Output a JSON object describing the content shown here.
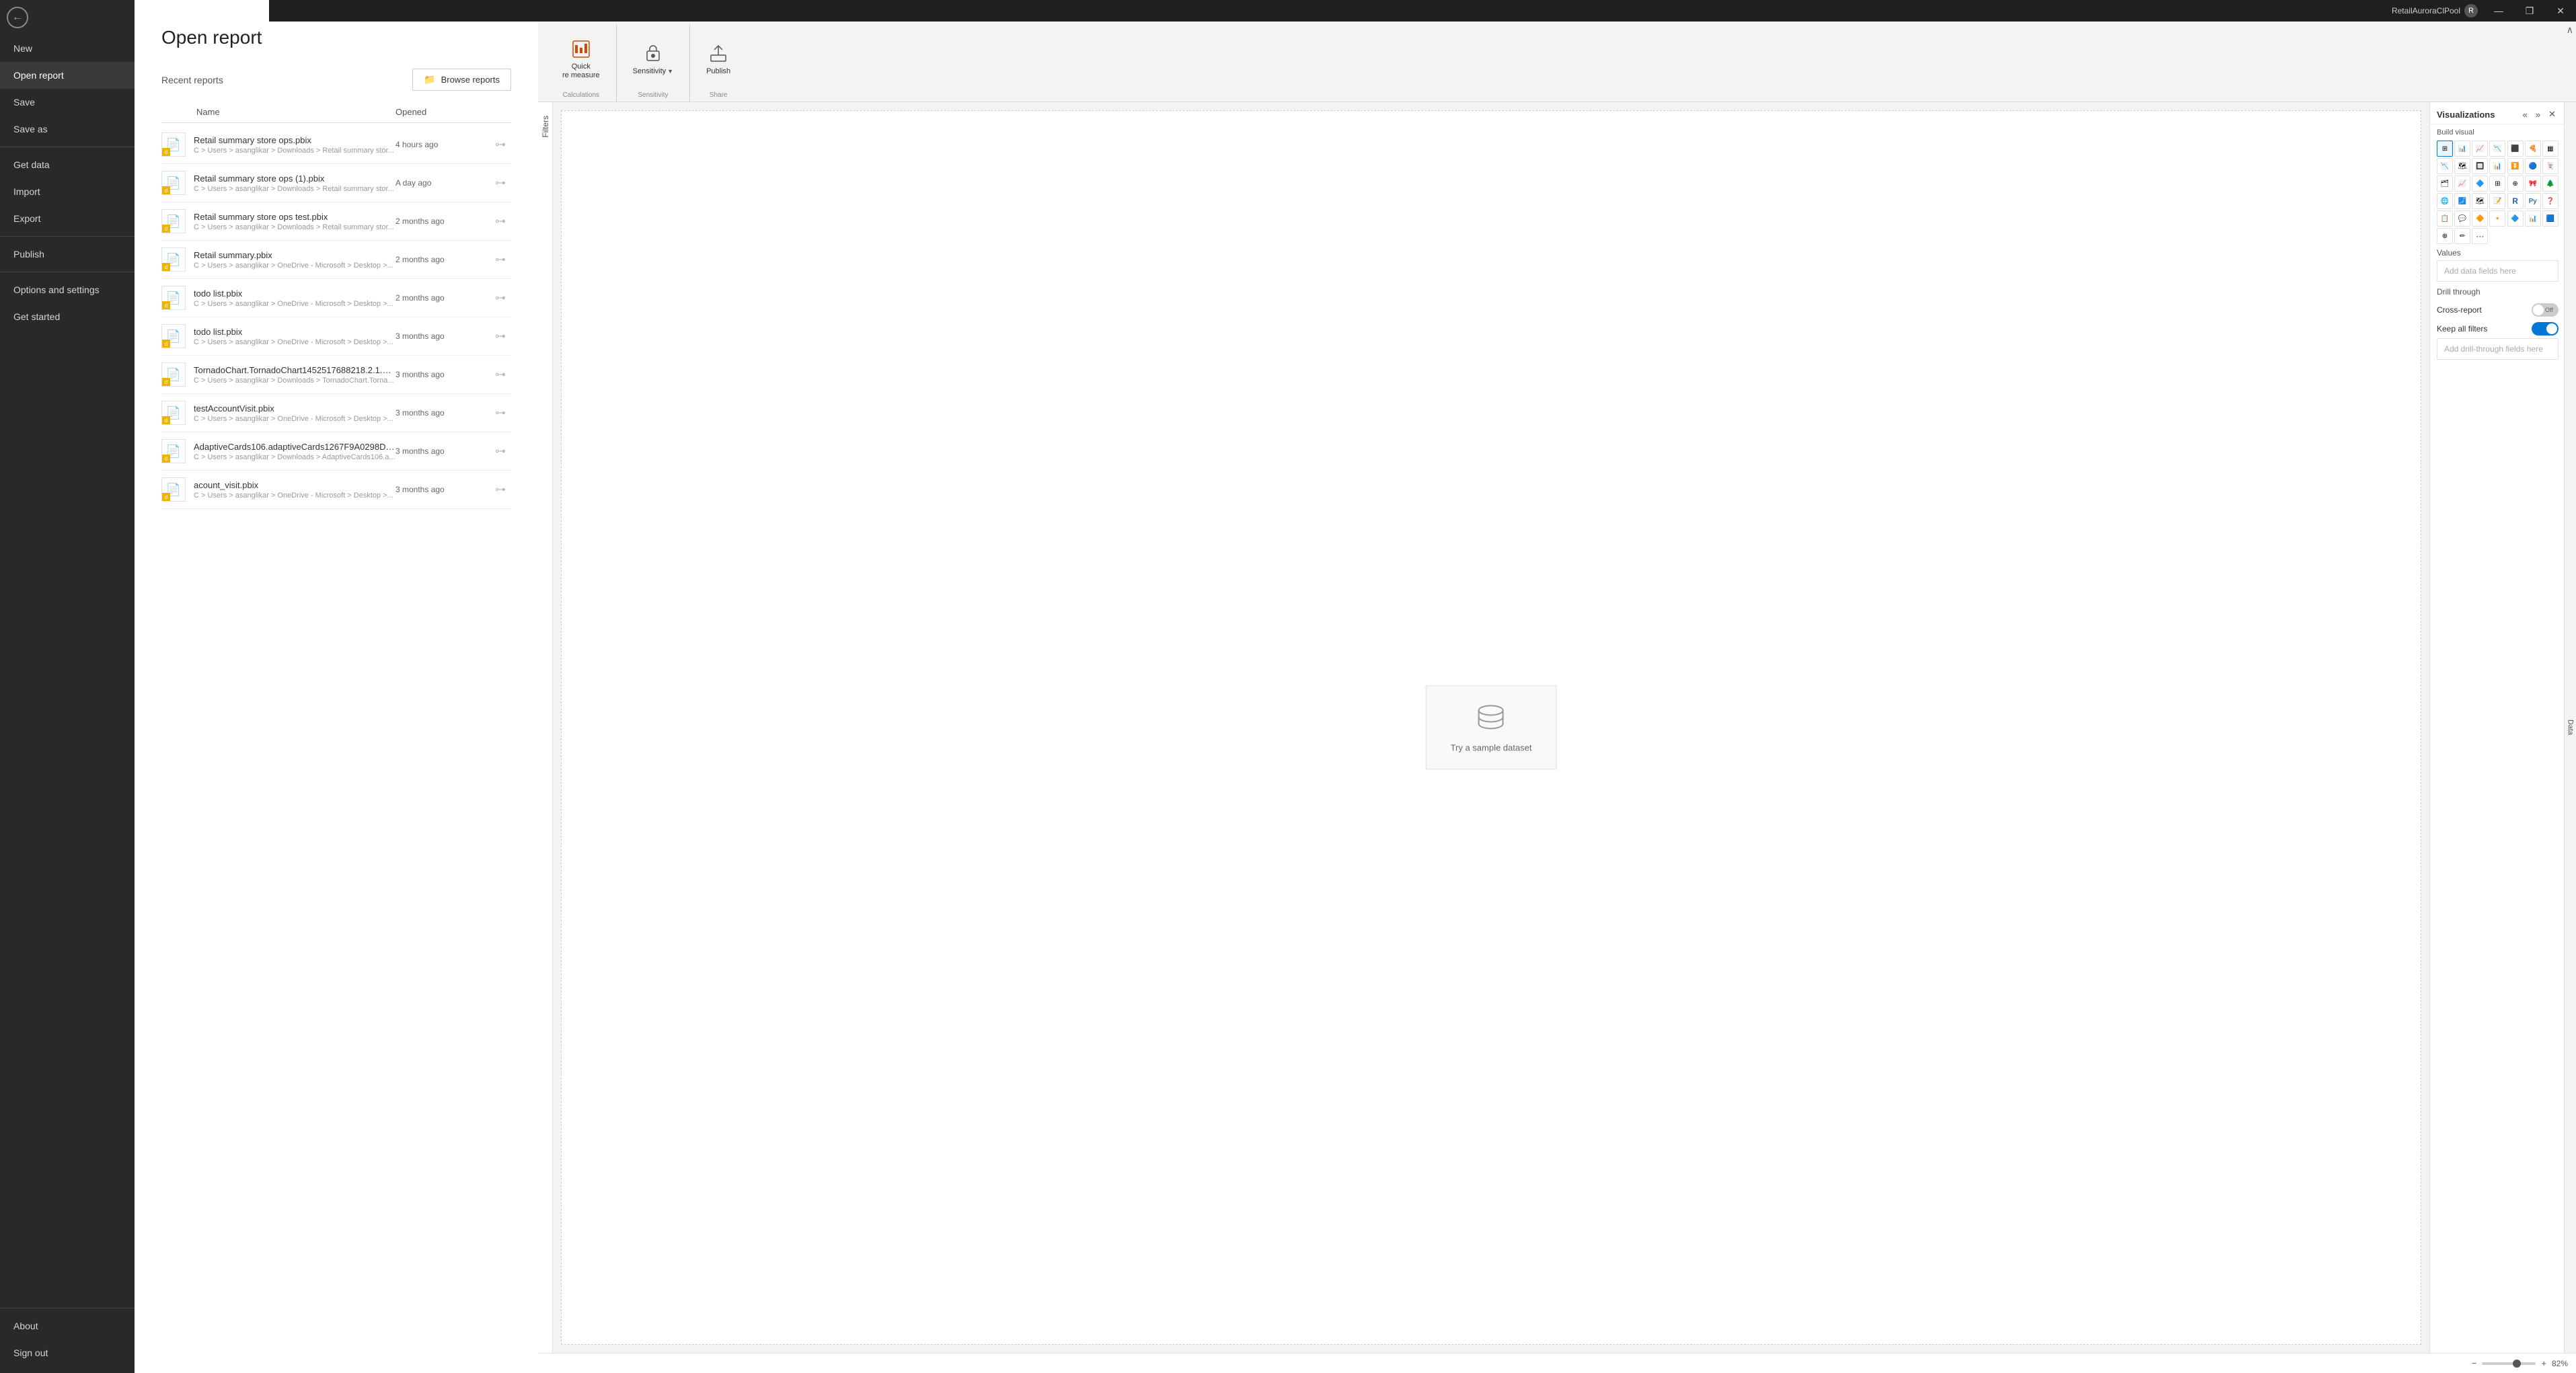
{
  "app": {
    "title": "RetailAuroraClPool",
    "user_initial": "R"
  },
  "titlebar": {
    "username": "RetailAuroraClPool",
    "minimize": "—",
    "restore": "❐",
    "close": "✕"
  },
  "sidebar": {
    "back_icon": "←",
    "items": [
      {
        "id": "new",
        "label": "New",
        "active": false
      },
      {
        "id": "open-report",
        "label": "Open report",
        "active": true
      },
      {
        "id": "save",
        "label": "Save",
        "active": false
      },
      {
        "id": "save-as",
        "label": "Save as",
        "active": false
      },
      {
        "id": "get-data",
        "label": "Get data",
        "active": false
      },
      {
        "id": "import",
        "label": "Import",
        "active": false
      },
      {
        "id": "export",
        "label": "Export",
        "active": false
      },
      {
        "id": "publish",
        "label": "Publish",
        "active": false
      },
      {
        "id": "options",
        "label": "Options and settings",
        "active": false
      },
      {
        "id": "get-started",
        "label": "Get started",
        "active": false
      }
    ],
    "bottom_items": [
      {
        "id": "about",
        "label": "About"
      },
      {
        "id": "sign-out",
        "label": "Sign out"
      }
    ]
  },
  "open_report": {
    "title": "Open report",
    "recent_label": "Recent reports",
    "browse_label": "Browse reports",
    "columns": {
      "name": "Name",
      "opened": "Opened"
    },
    "reports": [
      {
        "name": "Retail summary store ops.pbix",
        "path": "C > Users > asanglikar > Downloads > Retail summary stor...",
        "opened": "4 hours ago"
      },
      {
        "name": "Retail summary store ops (1).pbix",
        "path": "C > Users > asanglikar > Downloads > Retail summary stor...",
        "opened": "A day ago"
      },
      {
        "name": "Retail summary store ops test.pbix",
        "path": "C > Users > asanglikar > Downloads > Retail summary stor...",
        "opened": "2 months ago"
      },
      {
        "name": "Retail summary.pbix",
        "path": "C > Users > asanglikar > OneDrive - Microsoft > Desktop >...",
        "opened": "2 months ago"
      },
      {
        "name": "todo list.pbix",
        "path": "C > Users > asanglikar > OneDrive - Microsoft > Desktop >...",
        "opened": "2 months ago"
      },
      {
        "name": "todo list.pbix",
        "path": "C > Users > asanglikar > OneDrive - Microsoft > Desktop >...",
        "opened": "3 months ago"
      },
      {
        "name": "TornadoChart.TornadoChart1452517688218.2.1.0.0....",
        "path": "C > Users > asanglikar > Downloads > TornadoChart.Torna...",
        "opened": "3 months ago"
      },
      {
        "name": "testAccountVisit.pbix",
        "path": "C > Users > asanglikar > OneDrive - Microsoft > Desktop >...",
        "opened": "3 months ago"
      },
      {
        "name": "AdaptiveCards106.adaptiveCards1267F9A0298D43....",
        "path": "C > Users > asanglikar > Downloads > AdaptiveCards106.a...",
        "opened": "3 months ago"
      },
      {
        "name": "acount_visit.pbix",
        "path": "C > Users > asanglikar > OneDrive - Microsoft > Desktop >...",
        "opened": "3 months ago"
      }
    ]
  },
  "ribbon": {
    "groups": [
      {
        "id": "quick-measure",
        "label": "Calculations",
        "buttons": [
          {
            "id": "quick-measure",
            "icon": "⊞",
            "label": "Quick\nre measure",
            "orange": true
          }
        ]
      },
      {
        "id": "sensitivity",
        "label": "Sensitivity",
        "buttons": [
          {
            "id": "sensitivity-btn",
            "icon": "🔒",
            "label": "Sensitivity",
            "dropdown": true
          }
        ]
      },
      {
        "id": "share",
        "label": "Share",
        "buttons": [
          {
            "id": "publish-btn",
            "icon": "⬆",
            "label": "Publish"
          }
        ]
      }
    ]
  },
  "visualizations": {
    "title": "Visualizations",
    "build_visual_label": "Build visual",
    "collapse_icon": "«",
    "expand_icon": "»",
    "close_icon": "✕",
    "icon_rows": [
      [
        "▦",
        "📊",
        "📈",
        "📉",
        "🔲",
        "📊",
        "📊"
      ],
      [
        "📉",
        "🗺",
        "📊",
        "📊",
        "🔲",
        "📊"
      ],
      [
        "📊",
        "🔲",
        "📊",
        "📈",
        "⊕",
        "📊",
        "📊"
      ],
      [
        "🌐",
        "⋯",
        "📊",
        "🔲",
        "R",
        "Py",
        "📊"
      ],
      [
        "🔲",
        "💬",
        "📊",
        "📊",
        "📊",
        "📊"
      ],
      [
        "⊕",
        "✏",
        "⋯"
      ]
    ],
    "values_label": "Values",
    "add_fields_placeholder": "Add data fields here",
    "drill_through_label": "Drill through",
    "cross_report_label": "Cross-report",
    "cross_report_state": "Off",
    "keep_all_filters_label": "Keep all filters",
    "keep_all_filters_state": "On",
    "add_drill_through_placeholder": "Add drill-through fields here"
  },
  "canvas": {
    "sample_dataset_label": "Try a sample dataset"
  },
  "status_bar": {
    "zoom_level": "82%",
    "minus": "−",
    "plus": "+"
  }
}
